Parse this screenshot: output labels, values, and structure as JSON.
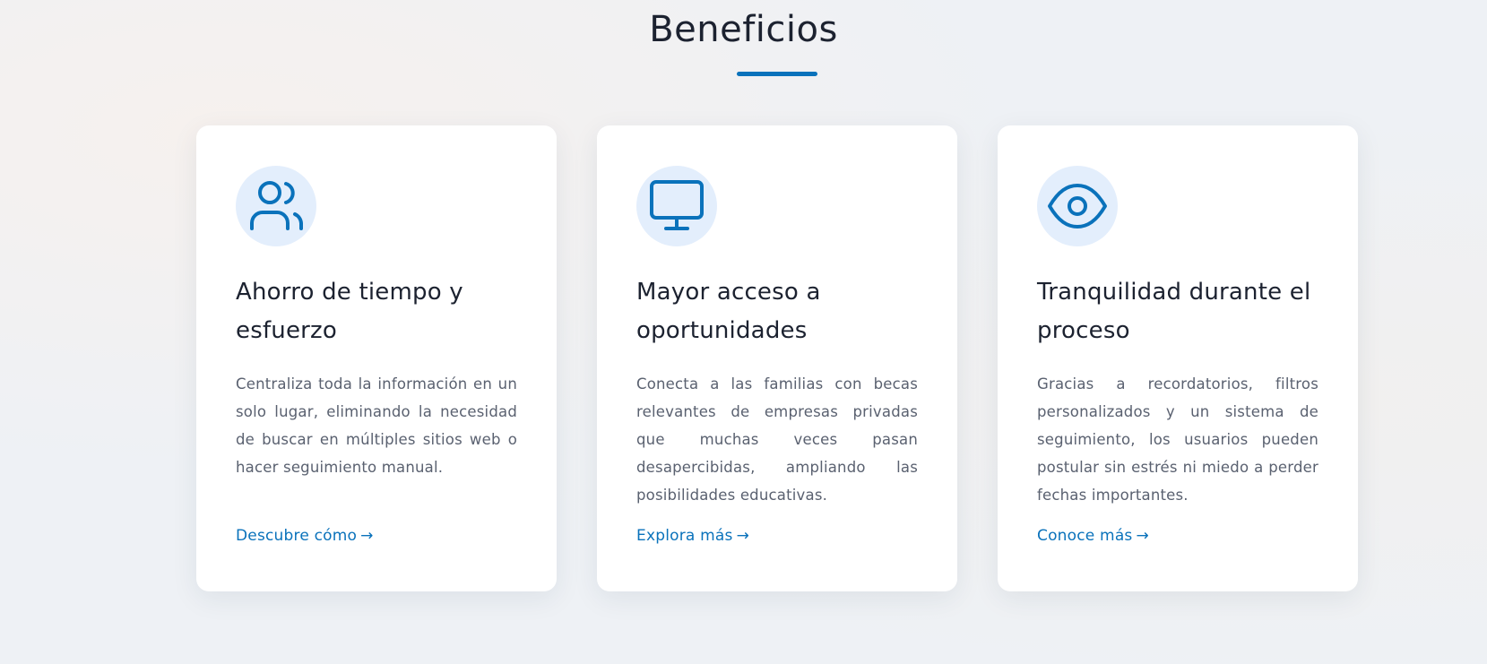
{
  "section": {
    "title": "Beneficios"
  },
  "colors": {
    "accent": "#0a72bb",
    "icon_bg": "#e3eefc",
    "heading": "#1c2230",
    "body_text": "#5a6170"
  },
  "cards": [
    {
      "icon": "users-icon",
      "title": "Ahorro de tiempo y esfuerzo",
      "text": "Centraliza toda la información en un solo lugar, eliminando la necesidad de buscar en múltiples sitios web o hacer seguimiento manual.",
      "link": "Descubre cómo",
      "arrow": "→"
    },
    {
      "icon": "monitor-icon",
      "title": "Mayor acceso a oportunidades",
      "text": "Conecta a las familias con becas relevantes de empresas privadas que muchas veces pasan desapercibidas, ampliando las posibilidades educativas.",
      "link": "Explora más",
      "arrow": "→"
    },
    {
      "icon": "eye-icon",
      "title": "Tranquilidad durante el proceso",
      "text": "Gracias a recordatorios, filtros personalizados y un sistema de seguimiento, los usuarios pueden postular sin estrés ni miedo a perder fechas importantes.",
      "link": "Conoce más",
      "arrow": "→"
    }
  ]
}
